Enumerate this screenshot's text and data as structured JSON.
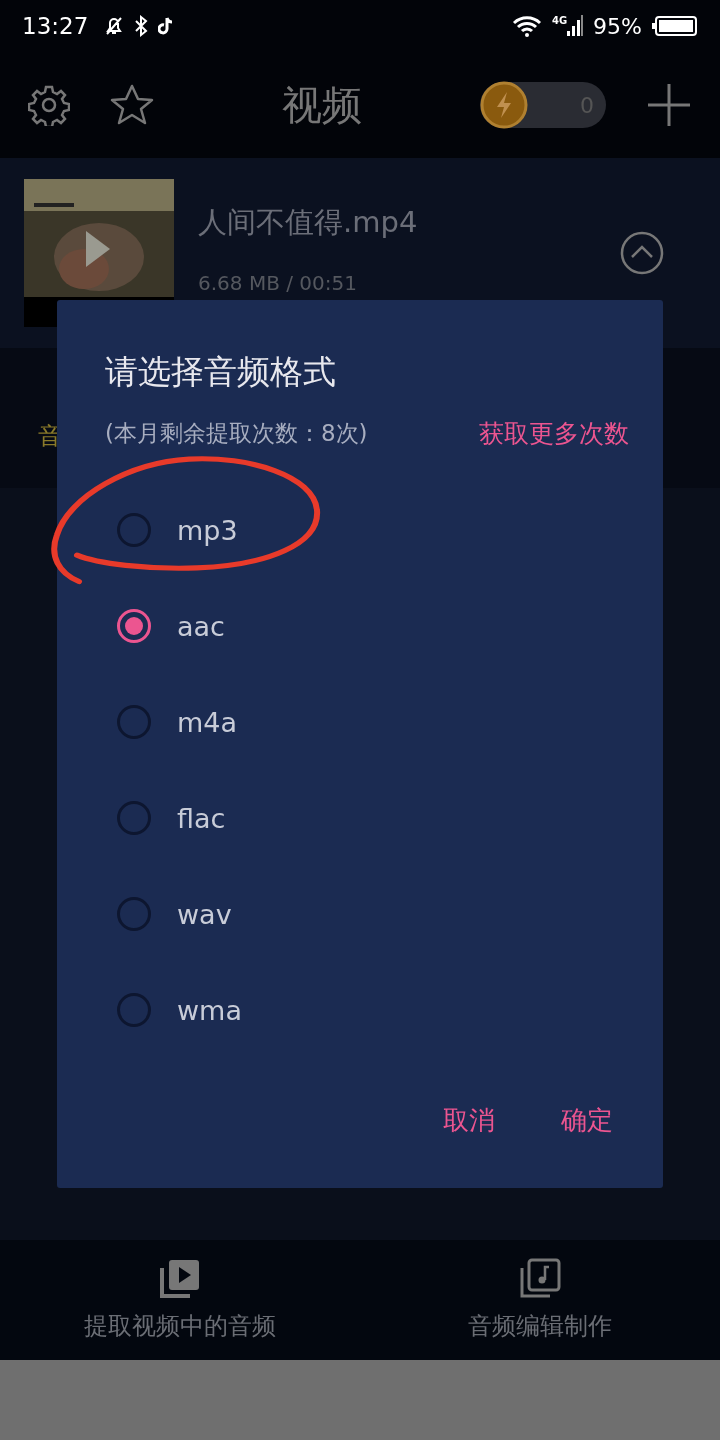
{
  "status_bar": {
    "time": "13:27",
    "network": "4G",
    "battery": "95%"
  },
  "header": {
    "title": "视频",
    "coin_count": "0"
  },
  "video": {
    "name": "人间不值得.mp4",
    "meta": "6.68 MB / 00:51",
    "expanded": true
  },
  "hidden_text": "音",
  "dialog": {
    "title": "请选择音频格式",
    "remaining": "(本月剩余提取次数：8次)",
    "get_more": "获取更多次数",
    "options": [
      {
        "label": "mp3",
        "selected": false,
        "circled": true
      },
      {
        "label": "aac",
        "selected": true,
        "circled": false
      },
      {
        "label": "m4a",
        "selected": false,
        "circled": false
      },
      {
        "label": "flac",
        "selected": false,
        "circled": false
      },
      {
        "label": "wav",
        "selected": false,
        "circled": false
      },
      {
        "label": "wma",
        "selected": false,
        "circled": false
      }
    ],
    "buttons": [
      "取消",
      "确定"
    ]
  },
  "bottom_nav": [
    {
      "kind": "video",
      "label": "提取视频中的音频"
    },
    {
      "kind": "audio",
      "label": "音频编辑制作"
    }
  ]
}
